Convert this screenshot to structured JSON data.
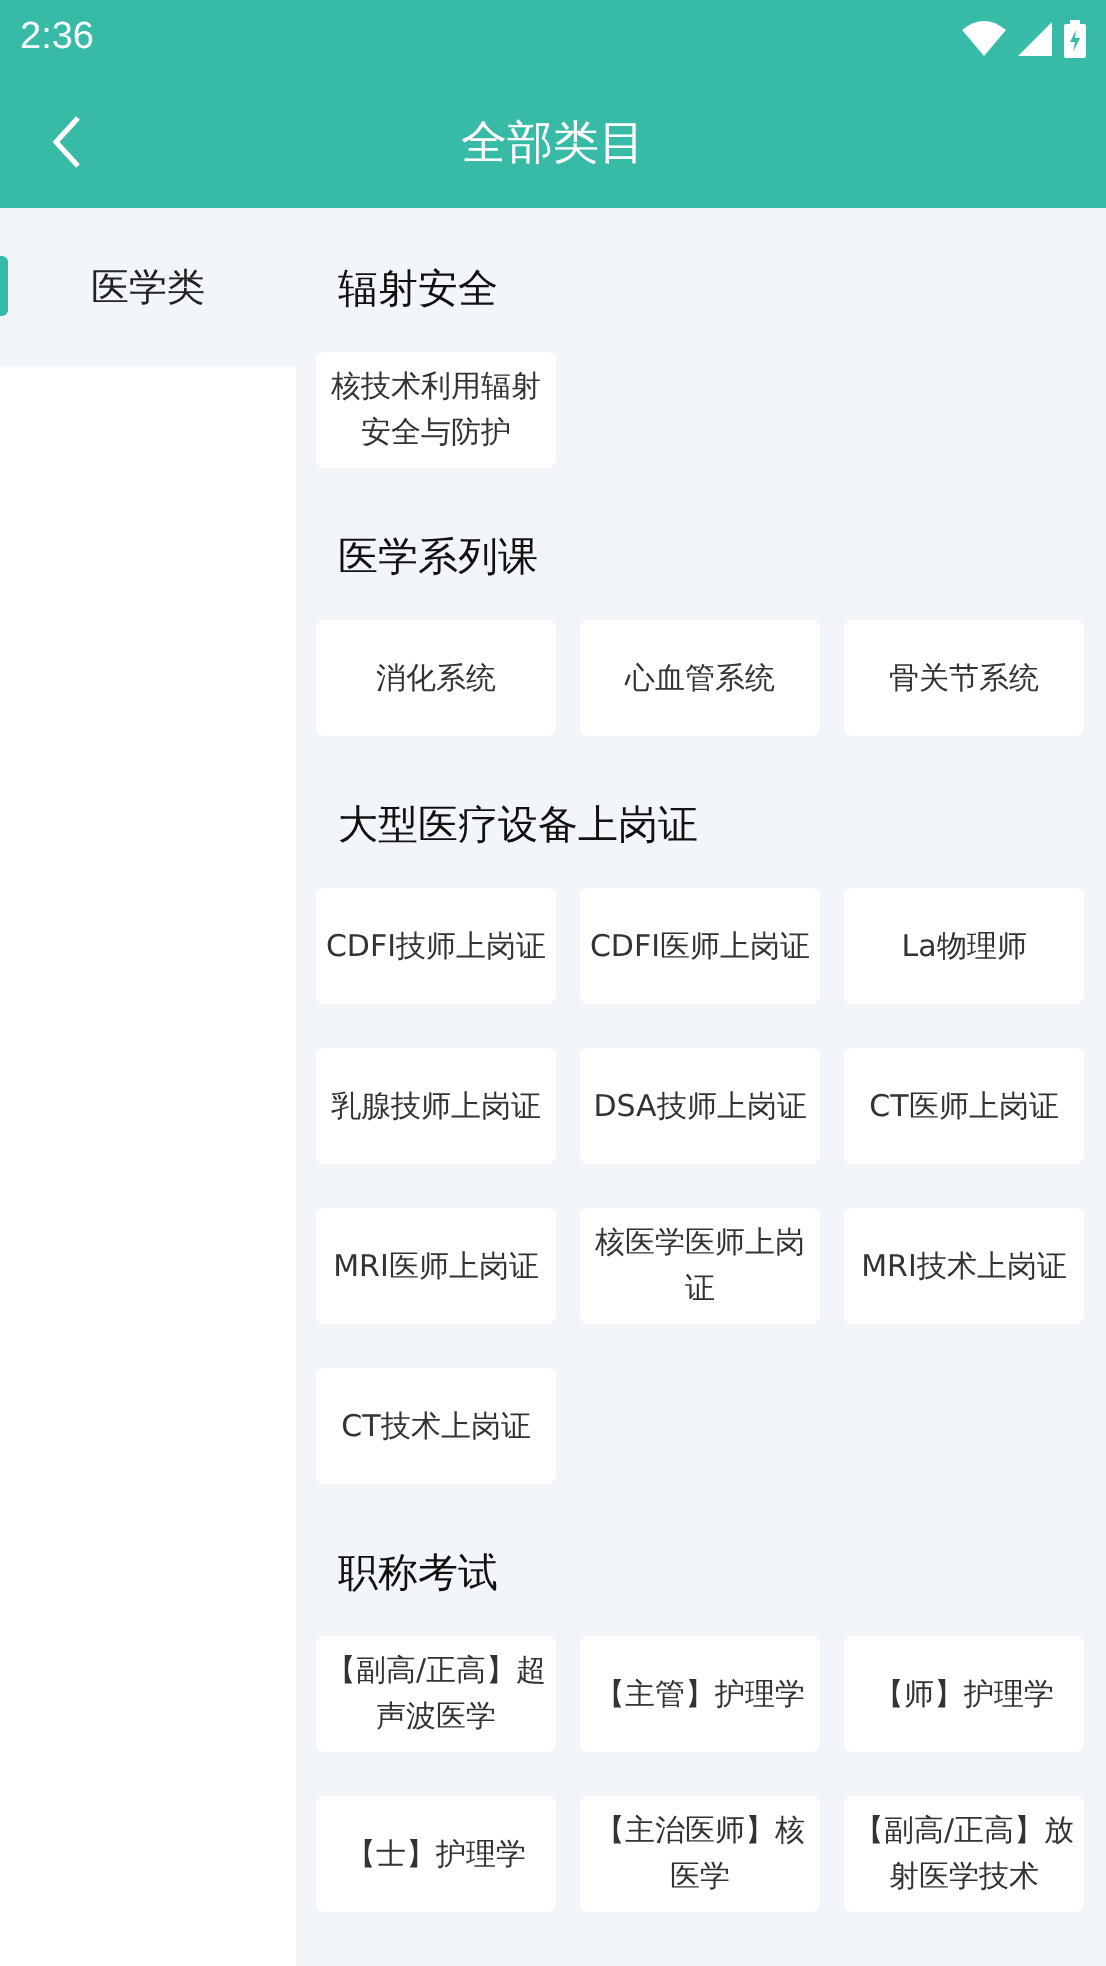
{
  "status_bar": {
    "time": "2:36"
  },
  "app_bar": {
    "title": "全部类目"
  },
  "sidebar": {
    "items": [
      {
        "label": "医学类",
        "selected": true
      }
    ]
  },
  "sections": [
    {
      "title": "辐射安全",
      "items": [
        "核技术利用辐射安全与防护"
      ]
    },
    {
      "title": "医学系列课",
      "items": [
        "消化系统",
        "心血管系统",
        "骨关节系统"
      ]
    },
    {
      "title": "大型医疗设备上岗证",
      "items": [
        "CDFI技师上岗证",
        "CDFI医师上岗证",
        "La物理师",
        "乳腺技师上岗证",
        "DSA技师上岗证",
        "CT医师上岗证",
        "MRI医师上岗证",
        "核医学医师上岗证",
        "MRI技术上岗证",
        "CT技术上岗证"
      ]
    },
    {
      "title": "职称考试",
      "items": [
        "【副高/正高】超声波医学",
        "【主管】护理学",
        "【师】护理学",
        "【士】护理学",
        "【主治医师】核医学",
        "【副高/正高】放射医学技术"
      ]
    }
  ]
}
